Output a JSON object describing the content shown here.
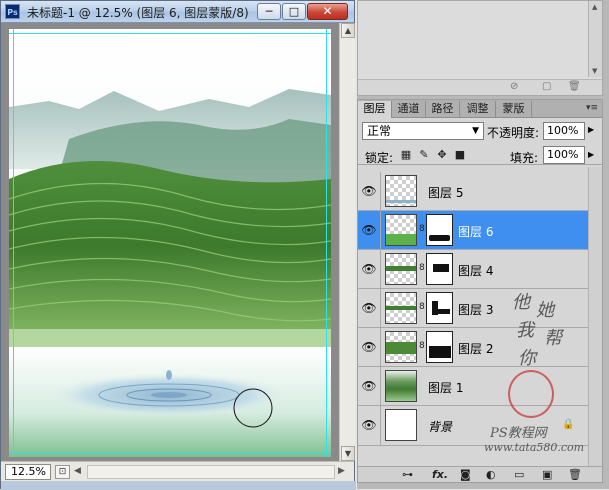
{
  "document": {
    "app_icon": "Ps",
    "title": "未标题-1 @ 12.5% (图层 6, 图层蒙版/8) *",
    "zoom": "12.5%",
    "buttons": {
      "minimize": "─",
      "maximize": "□",
      "close": "✕"
    }
  },
  "upper_panel": {
    "footer_icons": [
      "no-icon",
      "new-icon",
      "trash-icon"
    ]
  },
  "layers_panel": {
    "tabs": [
      {
        "label": "图层",
        "active": true
      },
      {
        "label": "通道",
        "active": false
      },
      {
        "label": "路径",
        "active": false
      },
      {
        "label": "调整",
        "active": false
      },
      {
        "label": "蒙版",
        "active": false
      }
    ],
    "blend_mode": "正常",
    "opacity_label": "不透明度:",
    "opacity": "100%",
    "lock_label": "锁定:",
    "fill_label": "填充:",
    "fill": "100%",
    "layers": [
      {
        "name": "图层 5",
        "visible": true,
        "selected": false,
        "has_mask": false,
        "locked": false
      },
      {
        "name": "图层 6",
        "visible": true,
        "selected": true,
        "has_mask": true,
        "locked": false
      },
      {
        "name": "图层 4",
        "visible": true,
        "selected": false,
        "has_mask": true,
        "locked": false
      },
      {
        "name": "图层 3",
        "visible": true,
        "selected": false,
        "has_mask": true,
        "locked": false
      },
      {
        "name": "图层 2",
        "visible": true,
        "selected": false,
        "has_mask": true,
        "locked": false
      },
      {
        "name": "图层 1",
        "visible": true,
        "selected": false,
        "has_mask": false,
        "locked": false
      },
      {
        "name": "背景",
        "visible": true,
        "selected": false,
        "has_mask": false,
        "locked": true
      }
    ],
    "footer_icons": [
      "link-icon",
      "fx-icon",
      "mask-icon",
      "adjustment-icon",
      "group-icon",
      "new-layer-icon",
      "trash-icon"
    ],
    "fx_label": "fx."
  },
  "watermark": {
    "chars": [
      "他",
      "她",
      "我",
      "帮",
      "你"
    ],
    "line1": "PS教程网",
    "line2": "www.tata580.com"
  },
  "colors": {
    "selection": "#3e8ff0",
    "guide": "#2fe0e8",
    "titlebar": "#b9cfe8"
  }
}
